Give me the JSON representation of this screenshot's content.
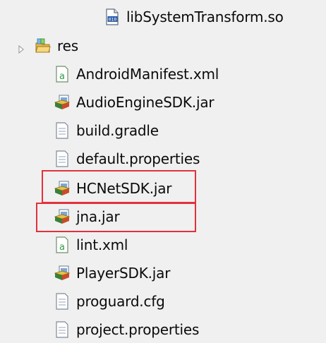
{
  "tree": {
    "items": [
      {
        "label": "libSystemTransform.so",
        "icon": "binary-file-icon"
      },
      {
        "label": "res",
        "icon": "folder-icon",
        "collapsed": true
      },
      {
        "label": "AndroidManifest.xml",
        "icon": "xml-file-icon"
      },
      {
        "label": "AudioEngineSDK.jar",
        "icon": "jar-file-icon"
      },
      {
        "label": "build.gradle",
        "icon": "text-file-icon"
      },
      {
        "label": "default.properties",
        "icon": "text-file-icon"
      },
      {
        "label": "HCNetSDK.jar",
        "icon": "jar-file-icon",
        "highlighted": true
      },
      {
        "label": "jna.jar",
        "icon": "jar-file-icon",
        "highlighted": true
      },
      {
        "label": "lint.xml",
        "icon": "xml-file-icon"
      },
      {
        "label": "PlayerSDK.jar",
        "icon": "jar-file-icon"
      },
      {
        "label": "proguard.cfg",
        "icon": "text-file-icon"
      },
      {
        "label": "project.properties",
        "icon": "text-file-icon"
      }
    ]
  },
  "colors": {
    "background": "#f0f0f0",
    "highlight_border": "#e2313c"
  }
}
